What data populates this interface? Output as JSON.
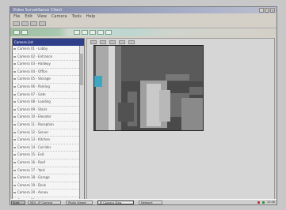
{
  "window": {
    "title": "Video Surveillance Client",
    "buttons": [
      "_",
      "□",
      "×"
    ]
  },
  "menu": [
    "File",
    "Edit",
    "View",
    "Camera",
    "Tools",
    "Help"
  ],
  "left_pane": {
    "header": "Camera List",
    "rows": [
      "Camera 01 - Lobby",
      "Camera 02 - Entrance",
      "Camera 03 - Hallway",
      "Camera 04 - Office",
      "Camera 05 - Storage",
      "Camera 06 - Parking",
      "Camera 07 - Gate",
      "Camera 08 - Loading",
      "Camera 09 - Stairs",
      "Camera 10 - Elevator",
      "Camera 11 - Reception",
      "Camera 12 - Server",
      "Camera 13 - Kitchen",
      "Camera 14 - Corridor",
      "Camera 15 - Exit",
      "Camera 16 - Roof",
      "Camera 17 - Yard",
      "Camera 18 - Garage",
      "Camera 19 - Dock",
      "Camera 20 - Annex",
      "Camera 21 - Lab"
    ]
  },
  "taskbar": {
    "start": "Start",
    "tasks": [
      "MDI - IP Camera",
      "Photo Viewer",
      "IP Camera View",
      "Network"
    ],
    "clock": "10:48"
  },
  "colors": {
    "title_bar": "#8a92ae",
    "selection": "#2f3f8a",
    "ribbon_accent": "#9fbf9f"
  }
}
